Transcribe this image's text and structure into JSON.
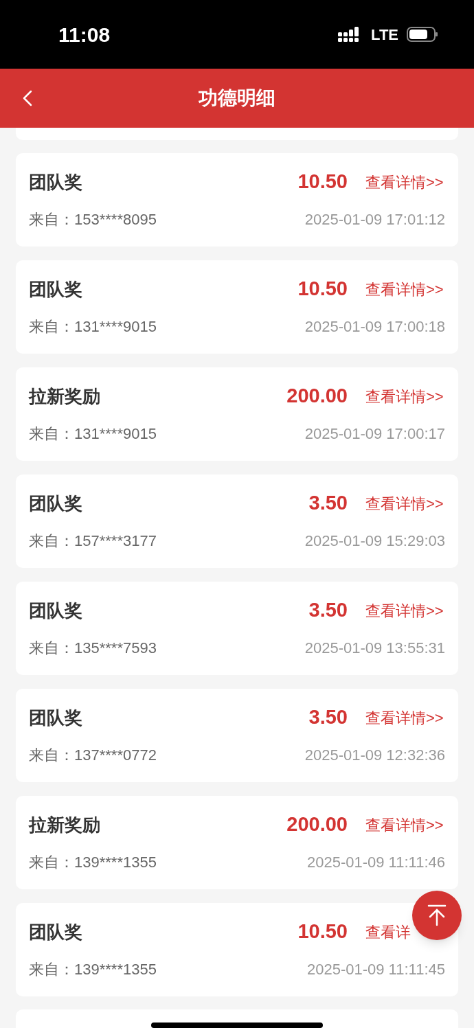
{
  "status_bar": {
    "time": "11:08",
    "network": "LTE"
  },
  "header": {
    "title": "功德明细"
  },
  "records": [
    {
      "title": "团队奖",
      "amount": "10.50",
      "link": "查看详情>>",
      "source": "来自：153****8095",
      "time": "2025-01-09 17:01:12"
    },
    {
      "title": "团队奖",
      "amount": "10.50",
      "link": "查看详情>>",
      "source": "来自：131****9015",
      "time": "2025-01-09 17:00:18"
    },
    {
      "title": "拉新奖励",
      "amount": "200.00",
      "link": "查看详情>>",
      "source": "来自：131****9015",
      "time": "2025-01-09 17:00:17"
    },
    {
      "title": "团队奖",
      "amount": "3.50",
      "link": "查看详情>>",
      "source": "来自：157****3177",
      "time": "2025-01-09 15:29:03"
    },
    {
      "title": "团队奖",
      "amount": "3.50",
      "link": "查看详情>>",
      "source": "来自：135****7593",
      "time": "2025-01-09 13:55:31"
    },
    {
      "title": "团队奖",
      "amount": "3.50",
      "link": "查看详情>>",
      "source": "来自：137****0772",
      "time": "2025-01-09 12:32:36"
    },
    {
      "title": "拉新奖励",
      "amount": "200.00",
      "link": "查看详情>>",
      "source": "来自：139****1355",
      "time": "2025-01-09 11:11:46"
    },
    {
      "title": "团队奖",
      "amount": "10.50",
      "link": "查看详",
      "source": "来自：139****1355",
      "time": "2025-01-09 11:11:45"
    }
  ]
}
